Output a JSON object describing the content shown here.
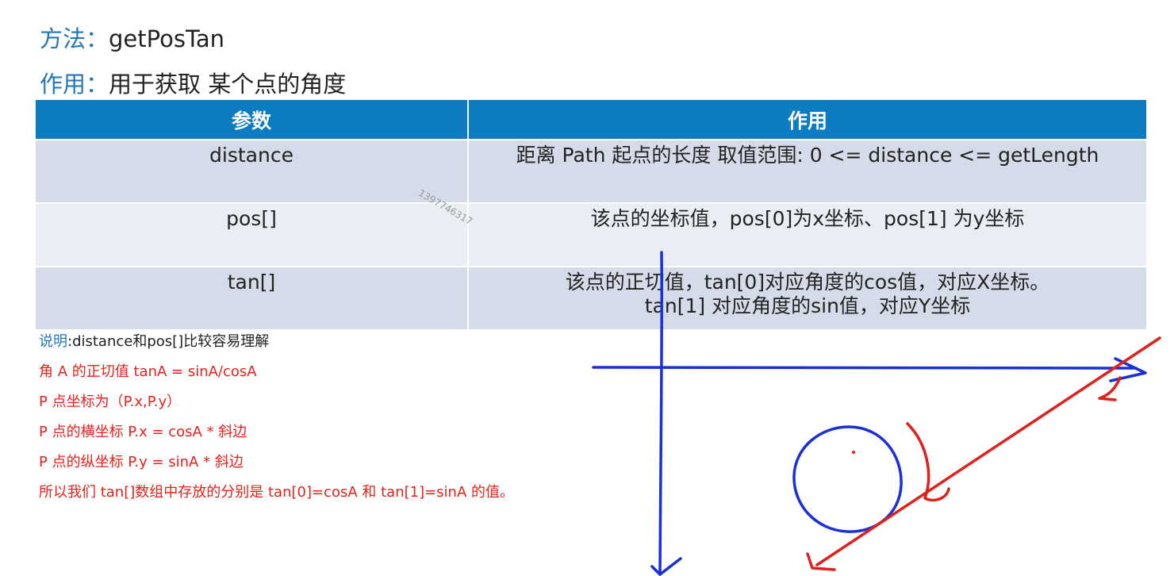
{
  "header": {
    "method_label": "方法：",
    "method_value": "getPosTan",
    "purpose_label": "作用：",
    "purpose_value": "用于获取 某个点的角度"
  },
  "table": {
    "columns": [
      "参数",
      "作用"
    ],
    "rows": [
      {
        "param": "distance",
        "desc": [
          "距离 Path 起点的长度 取值范围: 0 <= distance <= getLength"
        ]
      },
      {
        "param": "pos[]",
        "desc": [
          "该点的坐标值，pos[0]为x坐标、pos[1] 为y坐标"
        ]
      },
      {
        "param": "tan[]",
        "desc": [
          "该点的正切值，tan[0]对应角度的cos值，对应X坐标。",
          "tan[1] 对应角度的sin值，对应Y坐标"
        ]
      }
    ]
  },
  "watermark": "1397746317",
  "notes": {
    "intro_label": "说明",
    "intro_text": ":distance和pos[]比较容易理解",
    "lines": [
      "角 A 的正切值 tanA = sinA/cosA",
      "P 点坐标为（P.x,P.y）",
      "P 点的横坐标 P.x = cosA * 斜边",
      "P 点的纵坐标 P.y = sinA * 斜边",
      "所以我们 tan[]数组中存放的分别是 tan[0]=cosA 和 tan[1]=sinA 的值。"
    ]
  },
  "colors": {
    "accent_blue": "#2277bb",
    "table_header": "#0d7bc2",
    "row_dark": "#d5dbe8",
    "row_light": "#eaedf3",
    "annotation_red": "#e8221b",
    "pen_blue": "#1a2fd6",
    "pen_red": "#e0201a"
  }
}
